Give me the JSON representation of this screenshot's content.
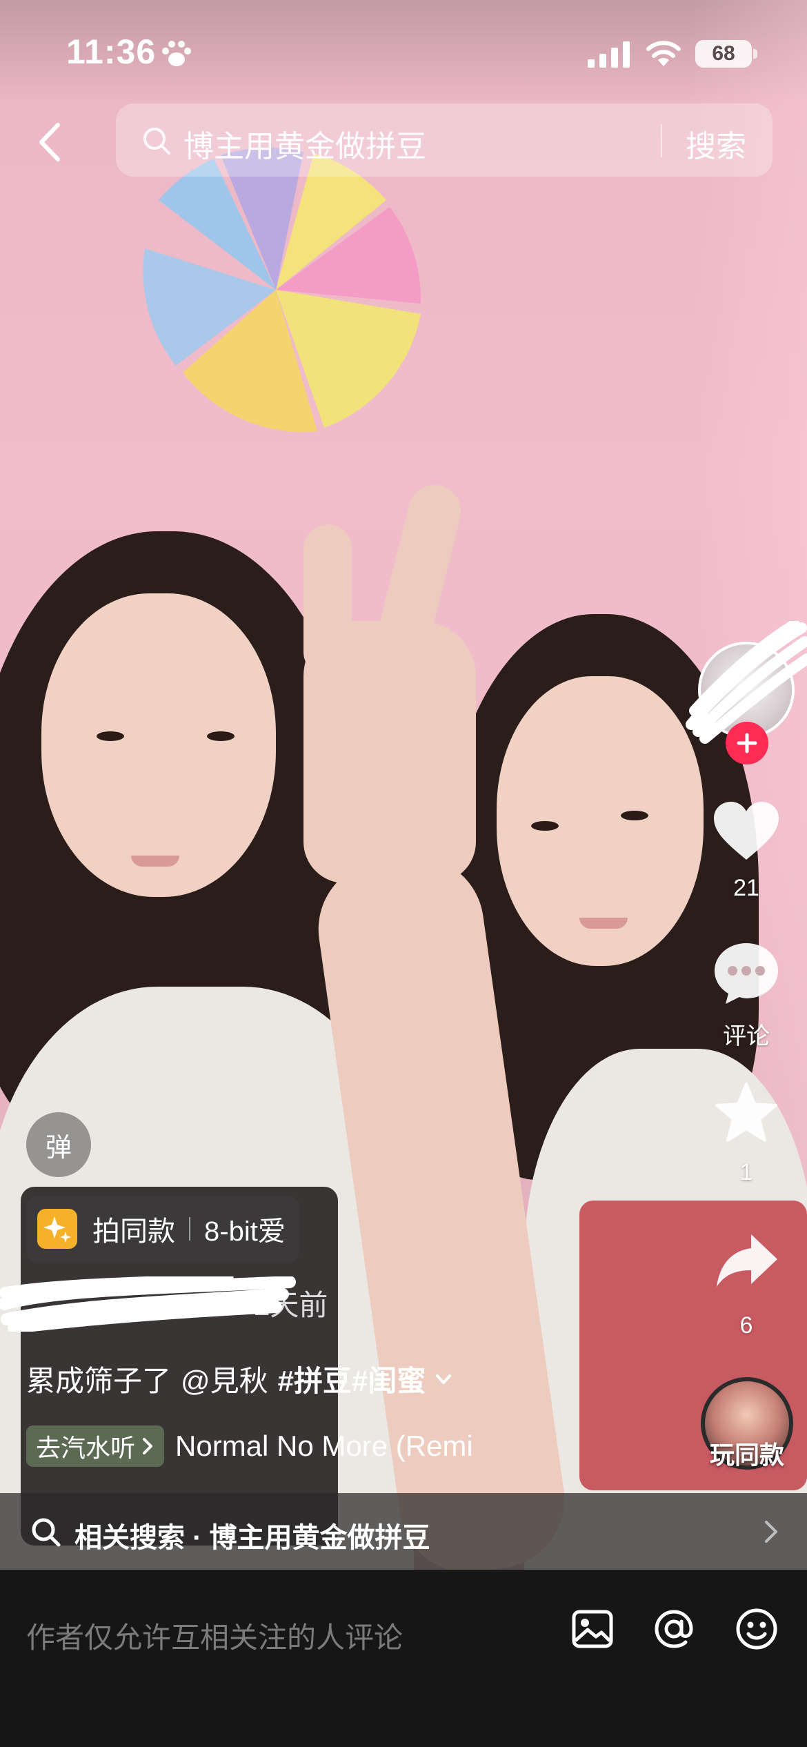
{
  "status_bar": {
    "time": "11:36",
    "battery": "68"
  },
  "search": {
    "query": "博主用黄金做拼豆",
    "button": "搜索"
  },
  "right_rail": {
    "likes": "21",
    "comments": "评论",
    "favorites": "1",
    "shares": "6",
    "play_same": "玩同款"
  },
  "info": {
    "danmaku": "弹",
    "template_label": "拍同款",
    "template_name": "8-bit爱",
    "post_time": "2天前",
    "caption_text": "累成筛子了",
    "caption_mention": "@見秋",
    "caption_tags": "#拼豆#闺蜜",
    "music_badge": "去汽水听",
    "music_title": "Normal No More (Remi"
  },
  "related": {
    "text": "相关搜索 · 博主用黄金做拼豆"
  },
  "comment_bar": {
    "placeholder": "作者仅允许互相关注的人评论"
  },
  "colors": {
    "accent": "#fe2c55",
    "wall": "#f1bccb",
    "bar": "#161616"
  },
  "icons": [
    "paw-icon",
    "signal-icon",
    "wifi-icon",
    "back-icon",
    "search-icon",
    "heart-icon",
    "comment-icon",
    "star-icon",
    "share-icon",
    "sparkle-icon",
    "chevron-down-icon",
    "chevron-right-icon",
    "image-icon",
    "at-icon",
    "emoji-icon"
  ]
}
